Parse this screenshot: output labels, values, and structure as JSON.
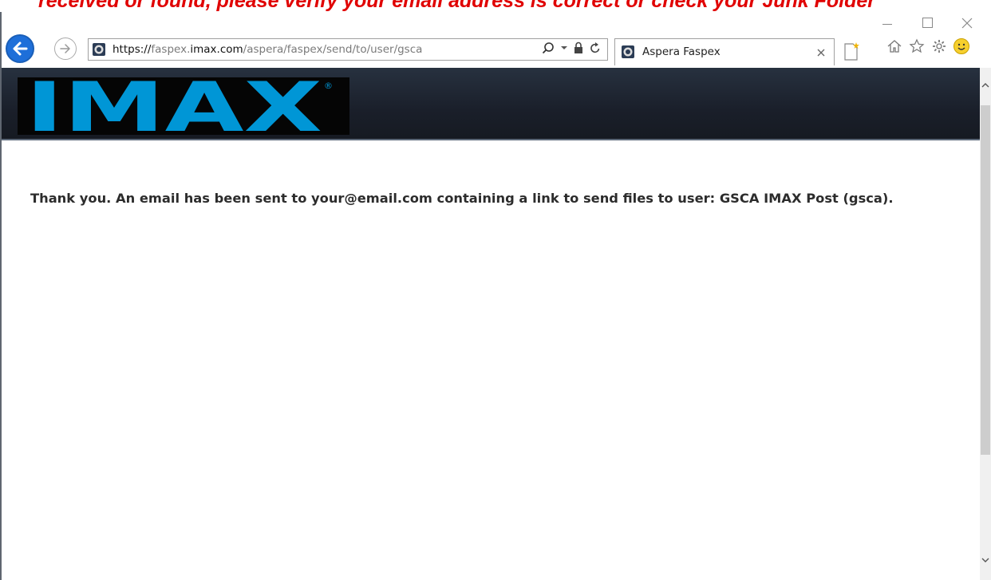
{
  "annotation": {
    "text": "received or found, please verify your email address is correct or check your Junk Folder"
  },
  "browser": {
    "url_prefix": "https://",
    "url_host_pre": "faspex.",
    "url_host_main": "imax.com",
    "url_path": "/aspera/faspex/send/to/user/gsca",
    "tab_title": "Aspera Faspex",
    "accent_color": "#1e6fd9"
  },
  "page": {
    "logo_text": "IMAX",
    "logo_mark": "®",
    "logo_color": "#0096d6",
    "message": "Thank you. An email has been sent to your@email.com containing a link to send files to user: GSCA IMAX Post (gsca)."
  }
}
